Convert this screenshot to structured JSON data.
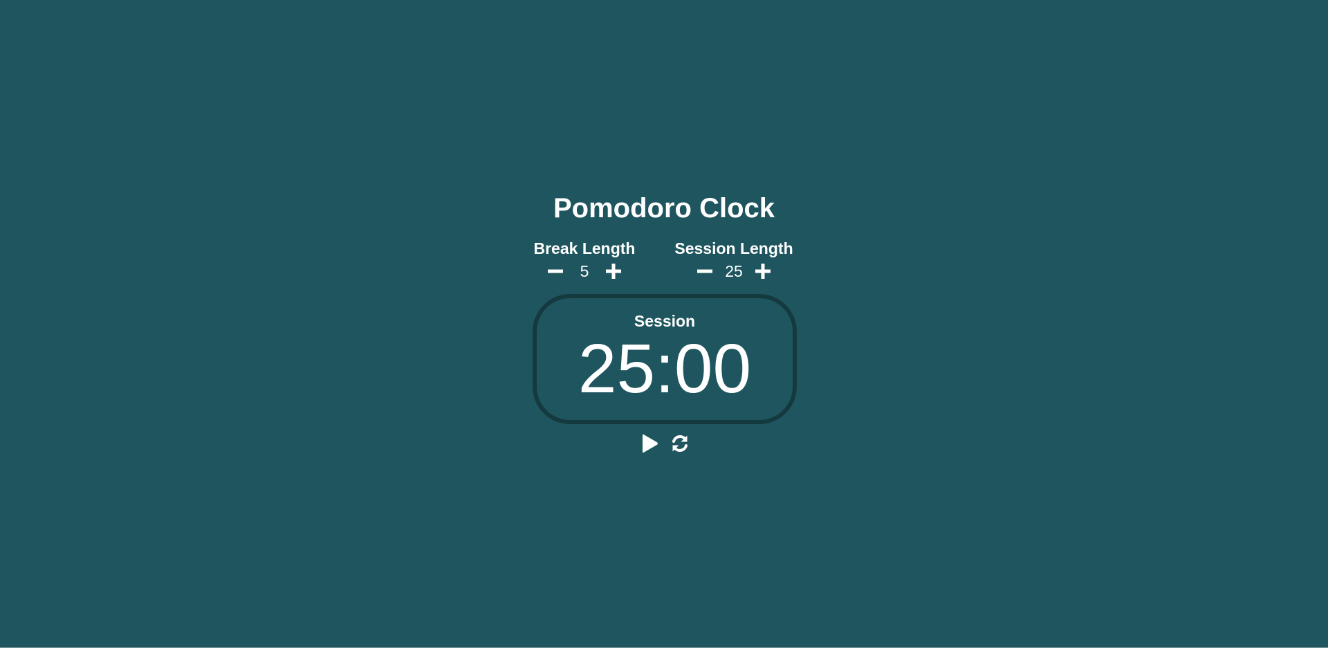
{
  "app": {
    "title": "Pomodoro Clock",
    "background_color": "#1f555e",
    "border_color": "#143a40"
  },
  "break": {
    "label": "Break Length",
    "value": "5",
    "decrement_icon": "minus-icon",
    "increment_icon": "plus-icon"
  },
  "session": {
    "label": "Session Length",
    "value": "25",
    "decrement_icon": "minus-icon",
    "increment_icon": "plus-icon"
  },
  "timer": {
    "label": "Session",
    "time_left": "25:00"
  },
  "playback": {
    "start_icon": "play-icon",
    "reset_icon": "refresh-icon"
  }
}
